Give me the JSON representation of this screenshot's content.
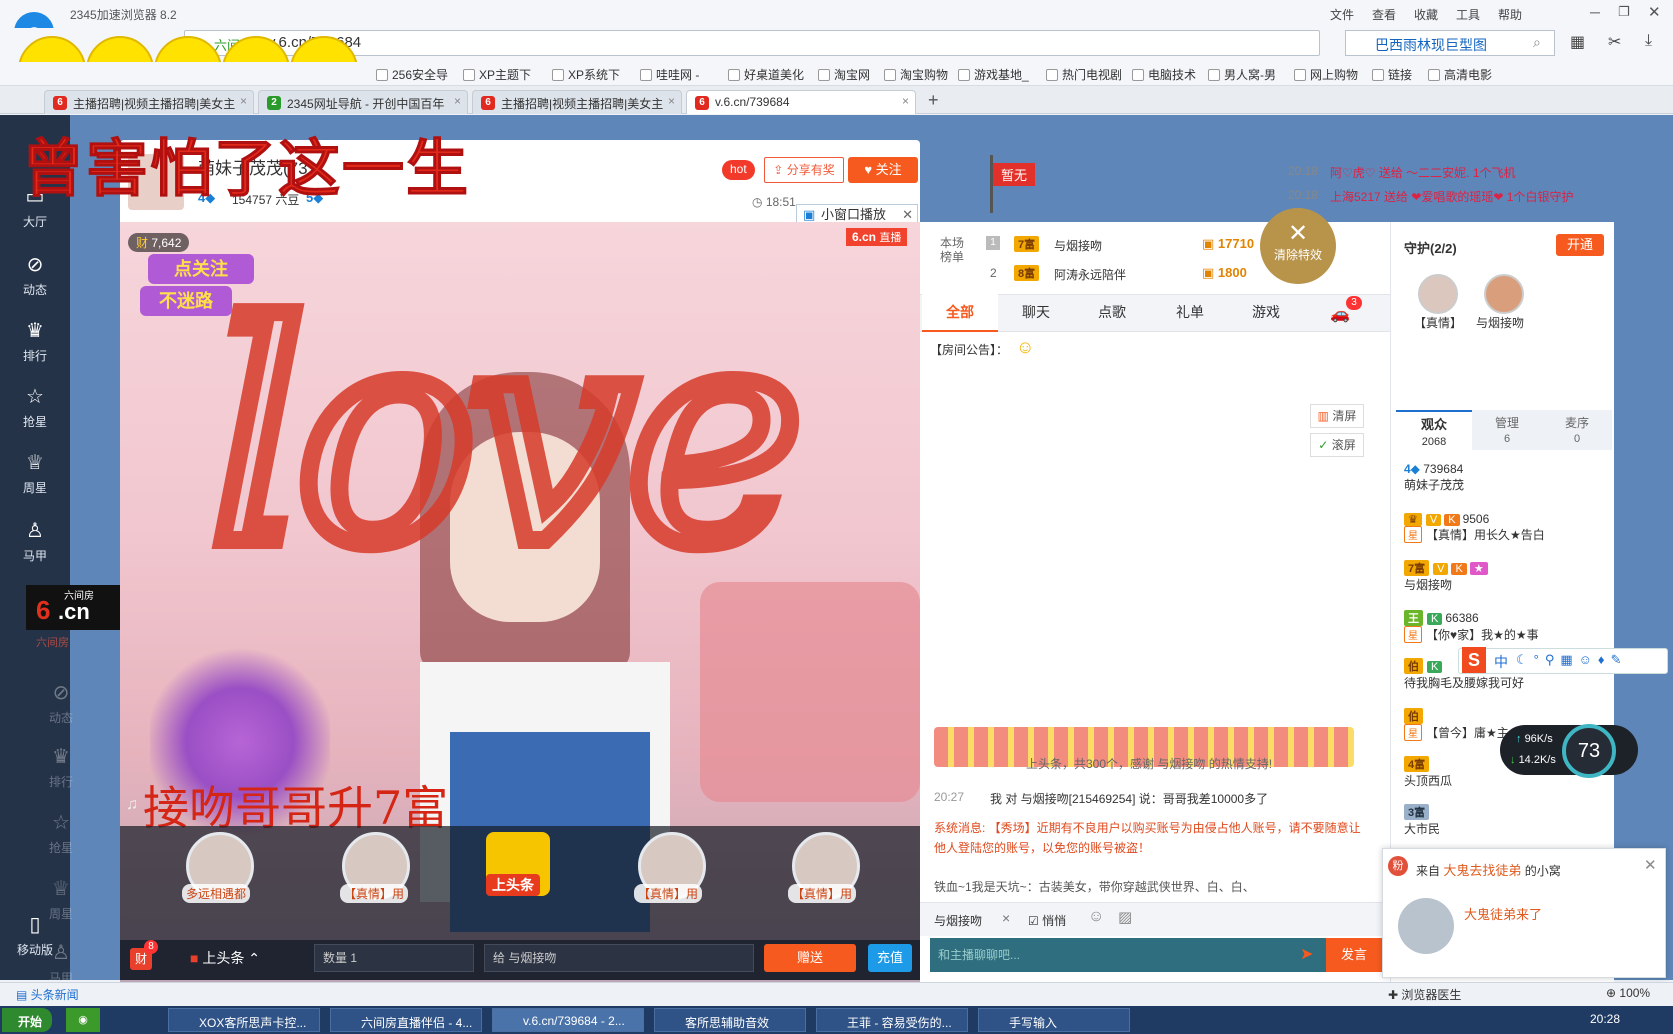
{
  "browser": {
    "title": "2345加速浏览器 8.2",
    "menus": [
      "文件",
      "查看",
      "收藏",
      "工具",
      "帮助"
    ],
    "address": "v.6.cn/739684",
    "address_prefix": "六间",
    "search_value": "巴西雨林现巨型图",
    "bookmarks": [
      "256安全导",
      "XP主题下",
      "XP系统下",
      "哇哇网 -",
      "好桌道美化",
      "淘宝网",
      "淘宝购物",
      "游戏基地_",
      "热门电视剧",
      "电脑技术",
      "男人窝-男",
      "网上购物",
      "链接",
      "高清电影"
    ],
    "tabs": [
      {
        "label": "主播招聘|视频主播招聘|美女主"
      },
      {
        "label": "2345网址导航 - 开创中国百年"
      },
      {
        "label": "主播招聘|视频主播招聘|美女主"
      },
      {
        "label": "v.6.cn/739684"
      }
    ]
  },
  "overlay_title": "曾害怕了这一生",
  "left_nav": [
    "大厅",
    "动态",
    "排行",
    "抢星",
    "周星",
    "马甲"
  ],
  "left_nav_ghost": [
    "动态",
    "排行",
    "抢星",
    "周星",
    "马甲"
  ],
  "left_nav_mobile": "移动版",
  "left_brand": "六间房",
  "anchor": {
    "name": "萌妹子茂茂(73",
    "level": "4",
    "beans": "154757 六豆",
    "beans_level": "5",
    "time": "18:51",
    "hot": "hot",
    "share": "分享有奖",
    "follow": "关注",
    "mini_window": "小窗口播放"
  },
  "zanwu": "暂无",
  "gift_feed": [
    {
      "time": "20:18",
      "text": "阿♡虎♡ 送给 〜二二安妮. 1个飞机"
    },
    {
      "time": "20:18",
      "text": "上海5217 送给 ❤爱唱歌的瑶瑶❤ 1个白银守护"
    }
  ],
  "clear_effects": "清除特效",
  "video": {
    "rich_count": "7,642",
    "follow_sticker_1": "点关注",
    "follow_sticker_2": "不迷路",
    "brand": "6.cn",
    "live": "直播",
    "kiss_text": "接吻哥哥升7富"
  },
  "rank": {
    "title": "本场榜单",
    "rows": [
      {
        "rank": "1",
        "level": "7富",
        "name": "与烟接吻",
        "score": "17710"
      },
      {
        "rank": "2",
        "level": "8富",
        "name": "阿涛永远陪伴",
        "score": "1800"
      }
    ]
  },
  "chat_tabs": [
    "全部",
    "聊天",
    "点歌",
    "礼单",
    "游戏"
  ],
  "car_badge": "3",
  "room_notice": "【房间公告】：",
  "clear_screen": "清屏",
  "scroll_screen": "滚屏",
  "messages": {
    "headline": "上头条，共300个，感谢 与烟接吻 的热情支持!",
    "chat_line": {
      "time": "20:27",
      "text": "我 对 与烟接吻[215469254] 说：哥哥我差10000多了"
    },
    "system": "系统消息: 【秀场】近期有不良用户以购买账号为由侵占他人账号，请不要随意让他人登陆您的账号，以免您的账号被盗！",
    "fans": "铁血~1我是天坑~：古装美女，带你穿越武侠世界、白、白、"
  },
  "chat_input": {
    "to": "与烟接吻",
    "whisper": "悄悄",
    "placeholder": "和主播聊聊吧...",
    "send": "发言"
  },
  "guard": {
    "title": "守护(2/2)",
    "open": "开通",
    "members": [
      "【真情】",
      "与烟接吻"
    ]
  },
  "audience_tabs": [
    {
      "label": "观众",
      "count": "2068"
    },
    {
      "label": "管理",
      "count": "6"
    },
    {
      "label": "麦序",
      "count": "0"
    }
  ],
  "viewers": [
    {
      "id": "739684",
      "name": "萌妹子茂茂"
    },
    {
      "id": "9506",
      "name": "【真情】用长久★告白"
    },
    {
      "id": "",
      "name": "与烟接吻"
    },
    {
      "id": "66386",
      "name": "【你♥家】我★的★事"
    },
    {
      "id": "",
      "name": "待我胸毛及腰嫁我可好"
    },
    {
      "id": "",
      "name": "【曾今】庸★主"
    },
    {
      "id": "",
      "name": "头顶西瓜"
    },
    {
      "id": "",
      "name": "大市民"
    }
  ],
  "ime": "中",
  "net_speed": {
    "up": "96K/s",
    "down": "14.2K/s",
    "percent": "73"
  },
  "popup": {
    "from": "来自",
    "name": "大鬼去找徒弟",
    "suffix": "的小窝",
    "msg": "大鬼徒弟来了"
  },
  "gift_panel": {
    "avatars": [
      "多远相遇都",
      "【真情】用",
      "上头条",
      "【真情】用",
      "【真情】用"
    ],
    "rich_label": "财",
    "rich_badge": "8",
    "headline": "上头条",
    "qty_label": "数量",
    "qty": "1",
    "to_label": "给",
    "to": "与烟接吻",
    "send": "赠送",
    "recharge": "充值"
  },
  "statusbar": {
    "news": "头条新闻",
    "doctor": "浏览器医生",
    "zoom": "100%"
  },
  "taskbar": {
    "start": "开始",
    "tasks": [
      "XOX客所思声卡控...",
      "六间房直播伴侣 - 4...",
      "v.6.cn/739684 - 2...",
      "客所思辅助音效",
      "王菲 - 容易受伤的...",
      "手写输入"
    ],
    "clock": "20:28"
  }
}
